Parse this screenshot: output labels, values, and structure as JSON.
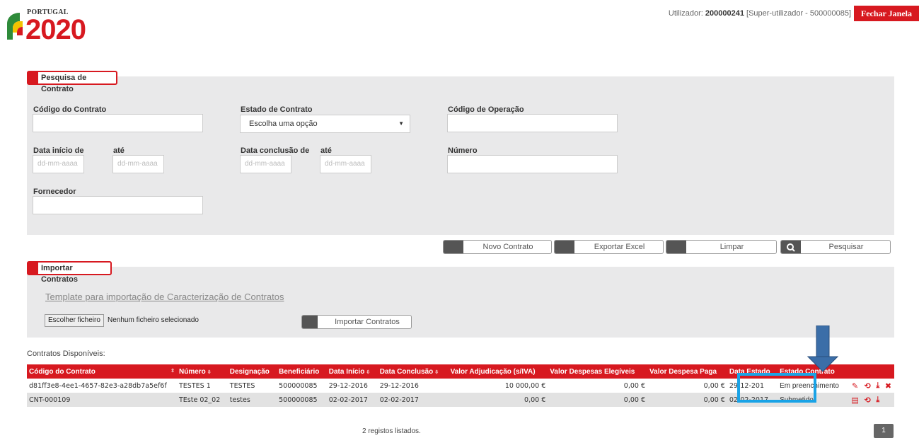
{
  "header": {
    "logo_country": "PORTUGAL",
    "logo_year": "2020",
    "user_prefix": "Utilizador:",
    "user_id": "200000241",
    "user_role": "[Super-utilizador - 500000085]",
    "logout_label": "Fechar Janela"
  },
  "search": {
    "section_title": "Pesquisa de Contrato",
    "contract_code_label": "Código do Contrato",
    "contract_code_value": "",
    "state_label": "Estado de Contrato",
    "state_selected": "Escolha uma opção",
    "operation_code_label": "Código de Operação",
    "operation_code_value": "",
    "start_date_label": "Data início de",
    "start_until_label": "até",
    "end_date_label": "Data conclusão de",
    "end_until_label": "até",
    "date_placeholder": "dd-mm-aaaa",
    "number_label": "Número",
    "number_value": "",
    "supplier_label": "Fornecedor",
    "supplier_value": ""
  },
  "actions": {
    "new_contract": "Novo Contrato",
    "export_excel": "Exportar Excel",
    "clear": "Limpar",
    "search": "Pesquisar"
  },
  "import": {
    "section_title": "Importar Contratos",
    "template_link": "Template para importação de Caracterização de Contratos",
    "file_button": "Escolher ficheiro",
    "file_status": "Nenhum ficheiro selecionado",
    "import_button": "Importar Contratos"
  },
  "results": {
    "caption": "Contratos Disponíveis:",
    "columns": [
      "Código do Contrato",
      "Número",
      "Designação",
      "Beneficiário",
      "Data Início",
      "Data Conclusão",
      "Valor Adjudicação (s/IVA)",
      "Valor Despesas Elegíveis",
      "Valor Despesa Paga",
      "Data Estado",
      "Estado Contrato"
    ],
    "rows": [
      {
        "code": "d81ff3e8-4ee1-4657-82e3-a28db7a5ef6f",
        "number": "TESTES 1",
        "designation": "TESTES",
        "beneficiary": "500000085",
        "start": "29-12-2016",
        "end": "29-12-2016",
        "adjudication": "10 000,00 €",
        "eligible": "0,00 €",
        "paid": "0,00 €",
        "state_date": "29-12-201",
        "state": "Em preenchimento"
      },
      {
        "code": "CNT-000109",
        "number": "TEste 02_02",
        "designation": "testes",
        "beneficiary": "500000085",
        "start": "02-02-2017",
        "end": "02-02-2017",
        "adjudication": "0,00 €",
        "eligible": "0,00 €",
        "paid": "0,00 €",
        "state_date": "02-02-2017",
        "state": "Submetido"
      }
    ],
    "count_text": "2 registos listados.",
    "page": "1"
  },
  "colors": {
    "brand_red": "#d71920",
    "panel_gray": "#e9e9ea",
    "highlight_blue": "#1aa3e6",
    "arrow_blue": "#3b6ea8"
  }
}
